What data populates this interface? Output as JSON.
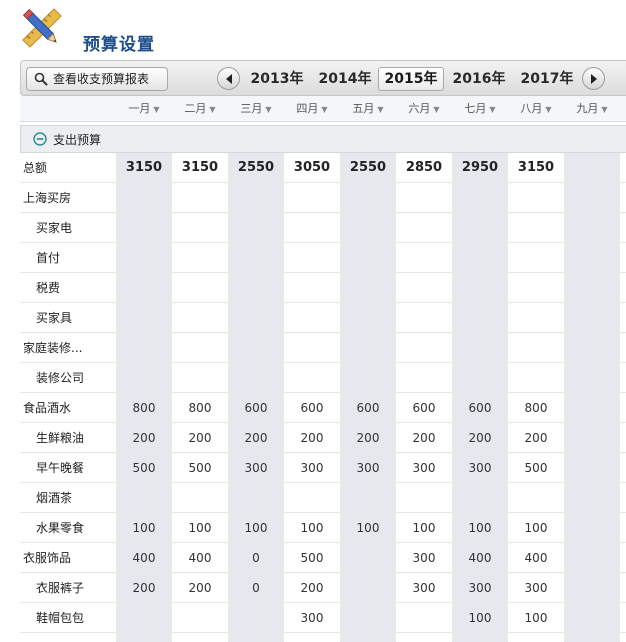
{
  "header": {
    "title": "预算设置"
  },
  "toolbar": {
    "report_button_label": "查看收支预算报表",
    "years": [
      "2013年",
      "2014年",
      "2015年",
      "2016年",
      "2017年"
    ],
    "active_year": "2015年"
  },
  "months": [
    "一月",
    "二月",
    "三月",
    "四月",
    "五月",
    "六月",
    "七月",
    "八月",
    "九月"
  ],
  "section": {
    "label": "支出预算"
  },
  "rows": [
    {
      "label": "总额",
      "type": "total",
      "values": [
        "3150",
        "3150",
        "2550",
        "3050",
        "2550",
        "2850",
        "2950",
        "3150",
        ""
      ]
    },
    {
      "label": "上海买房",
      "type": "cat",
      "values": [
        "",
        "",
        "",
        "",
        "",
        "",
        "",
        "",
        ""
      ]
    },
    {
      "label": "买家电",
      "type": "child",
      "values": [
        "",
        "",
        "",
        "",
        "",
        "",
        "",
        "",
        ""
      ]
    },
    {
      "label": "首付",
      "type": "child",
      "values": [
        "",
        "",
        "",
        "",
        "",
        "",
        "",
        "",
        ""
      ]
    },
    {
      "label": "税费",
      "type": "child",
      "values": [
        "",
        "",
        "",
        "",
        "",
        "",
        "",
        "",
        ""
      ]
    },
    {
      "label": "买家具",
      "type": "child",
      "values": [
        "",
        "",
        "",
        "",
        "",
        "",
        "",
        "",
        ""
      ]
    },
    {
      "label": "家庭装修...",
      "type": "cat",
      "values": [
        "",
        "",
        "",
        "",
        "",
        "",
        "",
        "",
        ""
      ]
    },
    {
      "label": "装修公司",
      "type": "child",
      "values": [
        "",
        "",
        "",
        "",
        "",
        "",
        "",
        "",
        ""
      ]
    },
    {
      "label": "食品酒水",
      "type": "cat",
      "values": [
        "800",
        "800",
        "600",
        "600",
        "600",
        "600",
        "600",
        "800",
        ""
      ]
    },
    {
      "label": "生鲜粮油",
      "type": "child",
      "values": [
        "200",
        "200",
        "200",
        "200",
        "200",
        "200",
        "200",
        "200",
        ""
      ]
    },
    {
      "label": "早午晚餐",
      "type": "child",
      "values": [
        "500",
        "500",
        "300",
        "300",
        "300",
        "300",
        "300",
        "500",
        ""
      ]
    },
    {
      "label": "烟酒茶",
      "type": "child",
      "values": [
        "",
        "",
        "",
        "",
        "",
        "",
        "",
        "",
        ""
      ]
    },
    {
      "label": "水果零食",
      "type": "child",
      "values": [
        "100",
        "100",
        "100",
        "100",
        "100",
        "100",
        "100",
        "100",
        ""
      ]
    },
    {
      "label": "衣服饰品",
      "type": "cat",
      "values": [
        "400",
        "400",
        "0",
        "500",
        "",
        "300",
        "400",
        "400",
        ""
      ]
    },
    {
      "label": "衣服裤子",
      "type": "child",
      "values": [
        "200",
        "200",
        "0",
        "200",
        "",
        "300",
        "300",
        "300",
        ""
      ]
    },
    {
      "label": "鞋帽包包",
      "type": "child",
      "values": [
        "",
        "",
        "",
        "300",
        "",
        "",
        "100",
        "100",
        ""
      ]
    }
  ],
  "icons": {
    "app": "pencil-ruler-icon",
    "search": "search-icon",
    "prev": "chevron-left-icon",
    "next": "chevron-right-icon",
    "collapse": "minus-circle-icon"
  },
  "colors": {
    "title": "#1f4e8c",
    "stripe": "#e5e8ed",
    "collapse_icon": "#2c8a8a"
  }
}
